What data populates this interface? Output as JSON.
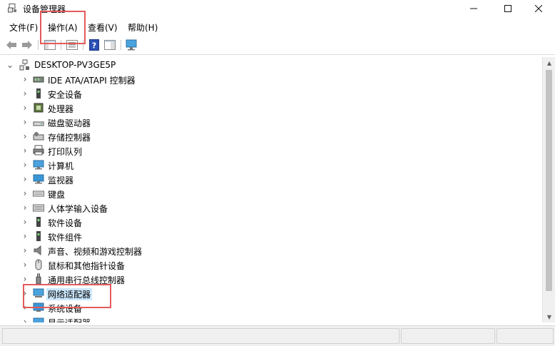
{
  "window": {
    "title": "设备管理器",
    "icon": "device-manager-icon",
    "controls": [
      "minimize",
      "maximize",
      "close"
    ]
  },
  "menu": [
    {
      "label": "文件(F)"
    },
    {
      "label": "操作(A)"
    },
    {
      "label": "查看(V)"
    },
    {
      "label": "帮助(H)"
    }
  ],
  "toolbar": [
    "back-arrow-icon",
    "forward-arrow-icon",
    "show-hide-console-tree-icon",
    "properties-icon",
    "help-icon",
    "action-pane-icon",
    "scan-hardware-icon"
  ],
  "tree": {
    "root": "DESKTOP-PV3GE5P",
    "root_icon": "computer-network-icon",
    "items": [
      {
        "label": "IDE ATA/ATAPI 控制器",
        "icon": "ide-controller-icon"
      },
      {
        "label": "安全设备",
        "icon": "security-device-icon"
      },
      {
        "label": "处理器",
        "icon": "processor-icon"
      },
      {
        "label": "磁盘驱动器",
        "icon": "disk-drive-icon"
      },
      {
        "label": "存储控制器",
        "icon": "storage-controller-icon"
      },
      {
        "label": "打印队列",
        "icon": "printer-icon"
      },
      {
        "label": "计算机",
        "icon": "computer-icon"
      },
      {
        "label": "监视器",
        "icon": "monitor-icon"
      },
      {
        "label": "键盘",
        "icon": "keyboard-icon"
      },
      {
        "label": "人体学输入设备",
        "icon": "hid-icon"
      },
      {
        "label": "软件设备",
        "icon": "software-device-icon"
      },
      {
        "label": "软件组件",
        "icon": "software-component-icon"
      },
      {
        "label": "声音、视频和游戏控制器",
        "icon": "speaker-icon"
      },
      {
        "label": "鼠标和其他指针设备",
        "icon": "mouse-icon"
      },
      {
        "label": "通用串行总线控制器",
        "icon": "usb-icon"
      },
      {
        "label": "网络适配器",
        "icon": "network-adapter-icon",
        "selected": true
      },
      {
        "label": "系统设备",
        "icon": "system-device-icon"
      },
      {
        "label": "显示适配器",
        "icon": "display-adapter-icon"
      }
    ]
  },
  "annotations": {
    "highlight_color": "#e35a5a",
    "highlighted": [
      "操作(A)",
      "网络适配器"
    ]
  }
}
